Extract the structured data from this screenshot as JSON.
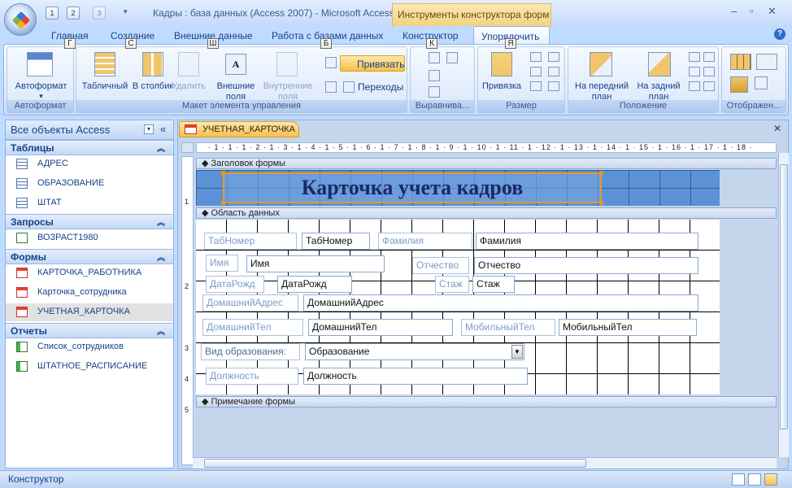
{
  "window": {
    "title": "Кадры : база данных (Access 2007) - Microsoft Access",
    "context_tools": "Инструменты конструктора форм"
  },
  "qat": {
    "key1": "1",
    "key2": "2",
    "key3": "3"
  },
  "tabs": [
    {
      "label": "Главная",
      "key": "Г"
    },
    {
      "label": "Создание",
      "key": "С"
    },
    {
      "label": "Внешние данные",
      "key": "Ш"
    },
    {
      "label": "Работа с базами данных",
      "key": "Б"
    },
    {
      "label": "Конструктор",
      "key": "К"
    },
    {
      "label": "Упорядочить",
      "key": "Я"
    }
  ],
  "ribbon": {
    "autoformat": {
      "button": "Автоформат",
      "group": "Автоформат"
    },
    "layout": {
      "tabular": "Табличный",
      "stacked": "В столбик",
      "remove": "Удалить",
      "outer_fields": "Внешние поля",
      "inner_fields": "Внутренние поля",
      "snap": "Привязать",
      "transitions": "Переходы",
      "group": "Макет элемента управления"
    },
    "align": {
      "group": "Выравнива..."
    },
    "size": {
      "snap_button": "Привязка",
      "group": "Размер"
    },
    "position": {
      "bring_front": "На передний план",
      "send_back": "На задний план",
      "group": "Положение"
    },
    "show": {
      "group": "Отображен..."
    }
  },
  "nav": {
    "title": "Все объекты Access",
    "sections": [
      {
        "name": "Таблицы",
        "items": [
          "АДРЕС",
          "ОБРАЗОВАНИЕ",
          "ШТАТ"
        ]
      },
      {
        "name": "Запросы",
        "items": [
          "ВОЗРАСТ1980"
        ]
      },
      {
        "name": "Формы",
        "items": [
          "КАРТОЧКА_РАБОТНИКА",
          "Карточка_сотрудника",
          "УЧЕТНАЯ_КАРТОЧКА"
        ]
      },
      {
        "name": "Отчеты",
        "items": [
          "Список_сотрудников",
          "ШТАТНОЕ_РАСПИСАНИЕ"
        ]
      }
    ]
  },
  "doc": {
    "tab": "УЧЕТНАЯ_КАРТОЧКА",
    "ruler": "· 1 · 1 · 1 · 2 · 1 · 3 · 1 · 4 · 1 · 5 · 1 · 6 · 1 · 7 · 1 · 8 · 1 · 9 · 1 · 10 · 1 · 11 · 1 · 12 · 1 · 13 · 1 · 14 · 1 · 15 · 1 · 16 · 1 · 17 · 1 · 18 ·",
    "sections": {
      "header": "Заголовок формы",
      "detail": "Область данных",
      "footer": "Примечание формы"
    },
    "form_title": "Карточка учета кадров",
    "controls": {
      "tabnum_label": "ТабНомер",
      "tabnum_field": "ТабНомер",
      "surname_label": "Фамилия",
      "surname_field": "Фамилия",
      "name_label": "Имя",
      "name_field": "Имя",
      "patronymic_label": "Отчество",
      "patronymic_field": "Отчество",
      "dob_label": "ДатаРожд",
      "dob_field": "ДатаРожд",
      "exp_label": "Стаж",
      "exp_field": "Стаж",
      "address_label": "ДомашнийАдрес",
      "address_field": "ДомашнийАдрес",
      "phone_label": "ДомашнийТел",
      "phone_field": "ДомашнийТел",
      "mobile_label": "МобильныйТел",
      "mobile_field": "МобильныйТел",
      "education_label": "Вид образования:",
      "education_field": "Образование",
      "position_label": "Должность",
      "position_field": "Должность"
    },
    "vruler": [
      "1",
      "2",
      "3",
      "4",
      "5"
    ]
  },
  "status": {
    "text": "Конструктор"
  }
}
